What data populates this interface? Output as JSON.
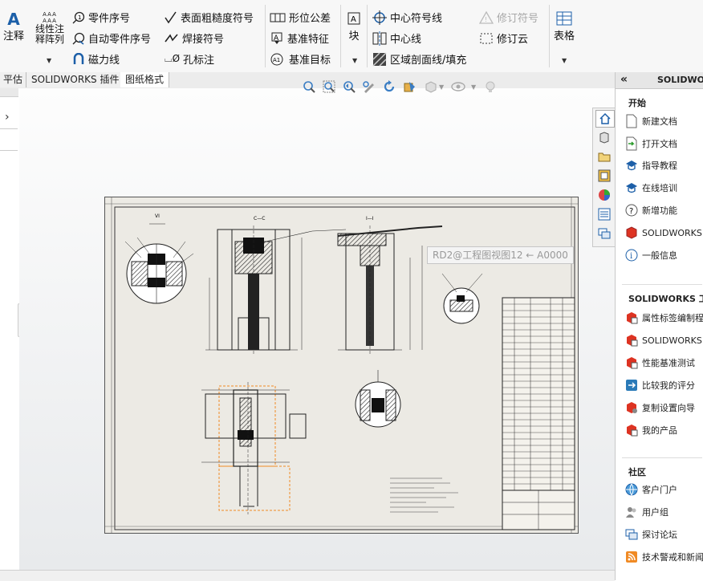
{
  "ribbon": {
    "annotation": "注释",
    "linear_pattern": "线性注释阵列",
    "balloon": "零件序号",
    "auto_balloon": "自动零件序号",
    "magnetic_line": "磁力线",
    "surface_finish": "表面粗糙度符号",
    "weld_symbol": "焊接符号",
    "hole_callout": "孔标注",
    "gtol": "形位公差",
    "datum_feature": "基准特征",
    "datum_target": "基准目标",
    "blocks": "块",
    "center_mark": "中心符号线",
    "centerline": "中心线",
    "area_hatch": "区域剖面线/填充",
    "revision_symbol": "修订符号",
    "revision_cloud": "修订云",
    "table": "表格"
  },
  "tabs": [
    "平估",
    "SOLIDWORKS 插件",
    "图纸格式"
  ],
  "canvas": {
    "tooltip": "RD2@工程图视图12 ← A0000",
    "view_labels": {
      "view1": "VI",
      "view2": "C—C",
      "view3": "I—I"
    }
  },
  "task_pane": {
    "header": "SOLIDWO",
    "sections": [
      {
        "title": "开始",
        "items": [
          "新建文档",
          "打开文档",
          "指导教程",
          "在线培训",
          "新增功能",
          "SOLIDWORKS",
          "一般信息"
        ]
      },
      {
        "title": "SOLIDWORKS 工具",
        "items": [
          "属性标签编制程",
          "SOLIDWORKS",
          "性能基准测试",
          "比较我的评分",
          "复制设置向导",
          "我的产品"
        ]
      },
      {
        "title": "社区",
        "items": [
          "客户门户",
          "用户组",
          "探讨论坛",
          "技术警戒和新闻"
        ]
      }
    ]
  },
  "colors": {
    "accent": "#1c5fa8",
    "orange_outline": "#f08a24",
    "sheet_bg": "#eceae4"
  }
}
